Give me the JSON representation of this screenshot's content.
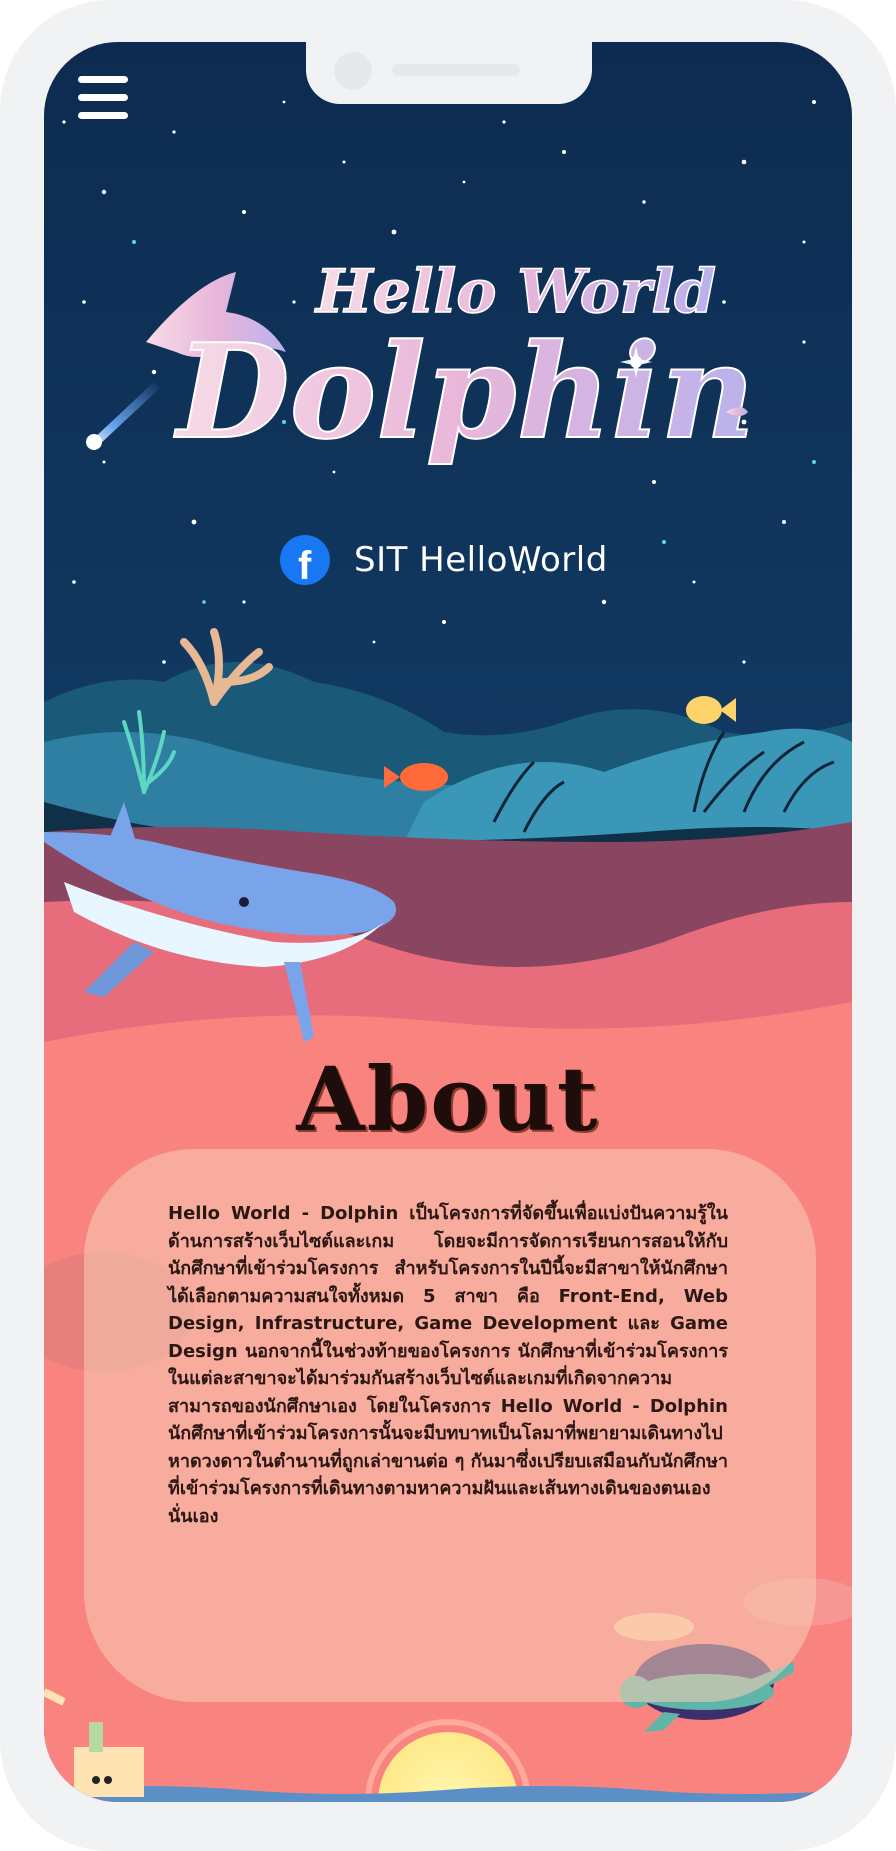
{
  "nav": {
    "menu_icon": "hamburger-menu-icon"
  },
  "hero": {
    "logo_line1": "Hello World",
    "logo_line2": "Dolphin"
  },
  "social": {
    "icon": "facebook-icon",
    "label": "SIT HelloWorld"
  },
  "about": {
    "title": "About",
    "body": "Hello World - Dolphin เป็นโครงการที่จัดขึ้นเพื่อแบ่งปันความรู้ในด้านการสร้างเว็บไซต์และเกม โดยจะมีการจัดการเรียนการสอนให้กับนักศึกษาที่เข้าร่วมโครงการ สำหรับโครงการในปีนี้จะมีสาขาให้นักศึกษาได้เลือกตามความสนใจทั้งหมด 5 สาขา คือ Front-End, Web Design, Infrastructure, Game Development และ Game Design นอกจากนี้ในช่วงท้ายของโครงการ นักศึกษาที่เข้าร่วมโครงการในแต่ละสาขาจะได้มาร่วมกันสร้างเว็บไซต์และเกมที่เกิดจากความสามารถของนักศึกษาเอง โดยในโครงการ Hello World - Dolphin นักศึกษาที่เข้าร่วมโครงการนั้นจะมีบทบาทเป็นโลมาที่พยายามเดินทางไปหาดวงดาวในตำนานที่ถูกเล่าขานต่อ ๆ กันมาซึ่งเปรียบเสมือนกับนักศึกษาที่เข้าร่วมโครงการที่เดินทางตามหาความฝันและเส้นทางเดินของตนเองนั่นเอง"
  },
  "colors": {
    "night_sky": "#0e2e55",
    "sea_pink": "#f9847f",
    "facebook_blue": "#1877f2",
    "title_dark": "#1e0d0b"
  }
}
